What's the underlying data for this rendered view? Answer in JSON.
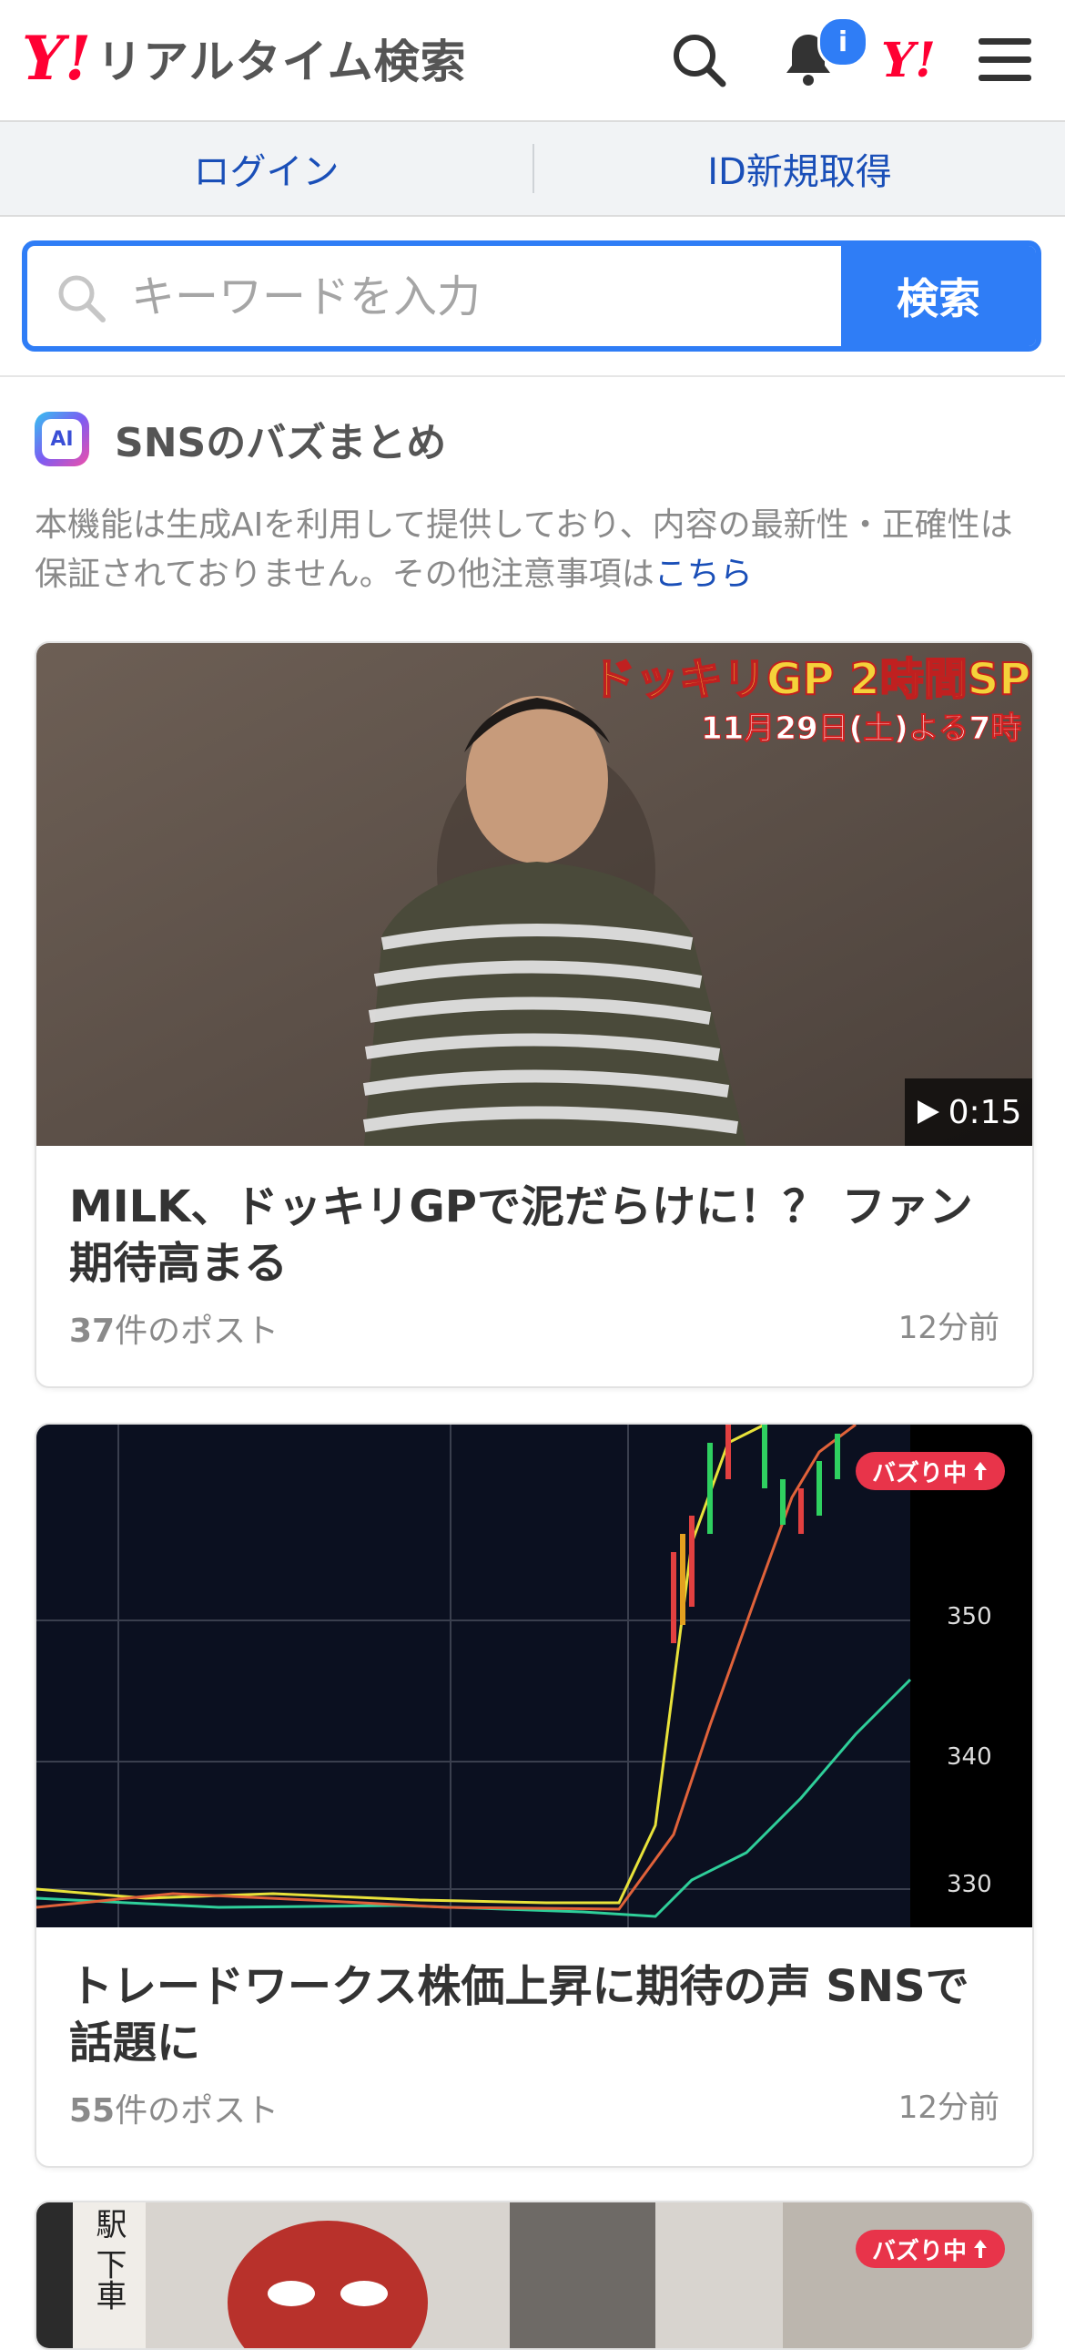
{
  "header": {
    "logo_y": "Y!",
    "logo_text": "リアルタイム検索",
    "notification_badge": "i",
    "yahoo_small": "Y!"
  },
  "auth": {
    "login_label": "ログイン",
    "register_label": "ID新規取得"
  },
  "search": {
    "placeholder": "キーワードを入力",
    "button_label": "検索"
  },
  "section": {
    "ai_label": "AI",
    "title": "SNSのバズまとめ",
    "disclaimer": "本機能は生成AIを利用して提供しており、内容の最新性・正確性は保証されておりません。その他注意事項は",
    "disclaimer_link": "こちら"
  },
  "cards": [
    {
      "title": "MILK、ドッキリGPで泥だらけに！？ ファン期待高まる",
      "post_count": "37",
      "post_suffix": "件のポスト",
      "time": "12分前",
      "video_duration": "0:15",
      "overlay_line1": "ドッキリGP 2時間SP",
      "overlay_line2": "11月29日(土)よる7時"
    },
    {
      "title": "トレードワークス株価上昇に期待の声 SNSで話題に",
      "post_count": "55",
      "post_suffix": "件のポスト",
      "time": "12分前",
      "buzz_label": "バズり中",
      "axis_labels": [
        "350",
        "340",
        "330"
      ]
    },
    {
      "buzz_label": "バズり中",
      "sign_text": "駅 下車"
    }
  ]
}
